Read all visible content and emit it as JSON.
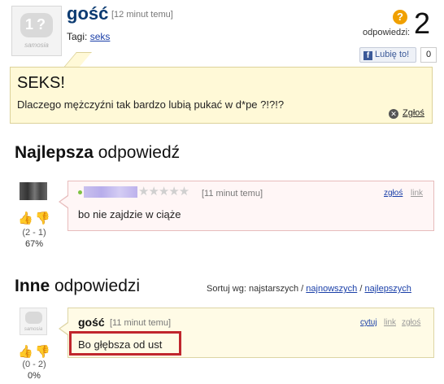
{
  "question": {
    "avatar_label": "samosia",
    "user": "gość",
    "time": "[12 minut temu]",
    "tags_label": "Tagi:",
    "tag": "seks",
    "answers_label": "odpowiedzi:",
    "answers_count": "2",
    "like_label": "Lubię to!",
    "like_count": "0",
    "title": "SEKS!",
    "body": "Dlaczego mężczyźni tak bardzo lubią pukać w d*pe ?!?!?",
    "report_label": "Zgłoś"
  },
  "best_section": {
    "bold": "Najlepsza",
    "rest": " odpowiedź"
  },
  "best_answer": {
    "stars": "★★★★★",
    "time": "[11 minut temu]",
    "report": "zgłoś",
    "link": "link",
    "text": "bo nie zajdzie w ciąże",
    "votes": "(2 - 1)",
    "percent": "67%"
  },
  "other_section": {
    "bold": "Inne",
    "rest": " odpowiedzi"
  },
  "sort": {
    "label": "Sortuj wg: najstarszych /",
    "newest": "najnowszych",
    "sep": "/",
    "best": "najlepszych"
  },
  "other_answer": {
    "avatar_label": "samosia",
    "user": "gość",
    "time": "[11 minut temu]",
    "quote": "cytuj",
    "link": "link",
    "report": "zgłoś",
    "text": "Bo głębsza od ust",
    "votes": "(0 - 2)",
    "percent": "0%"
  },
  "icons": {
    "thumb_up": "thumbs-up-icon",
    "thumb_down": "thumbs-down-icon",
    "answers": "question-mark-icon",
    "report": "close-circle-icon",
    "facebook": "facebook-icon",
    "online": "online-status-icon"
  },
  "colors": {
    "question_bg": "#fff9d7",
    "best_answer_bg": "#fff6f6",
    "other_answer_bg": "#fffbe6",
    "highlight_border": "#c0262d",
    "username": "#0c3b72",
    "answers_icon": "#f0a000"
  }
}
